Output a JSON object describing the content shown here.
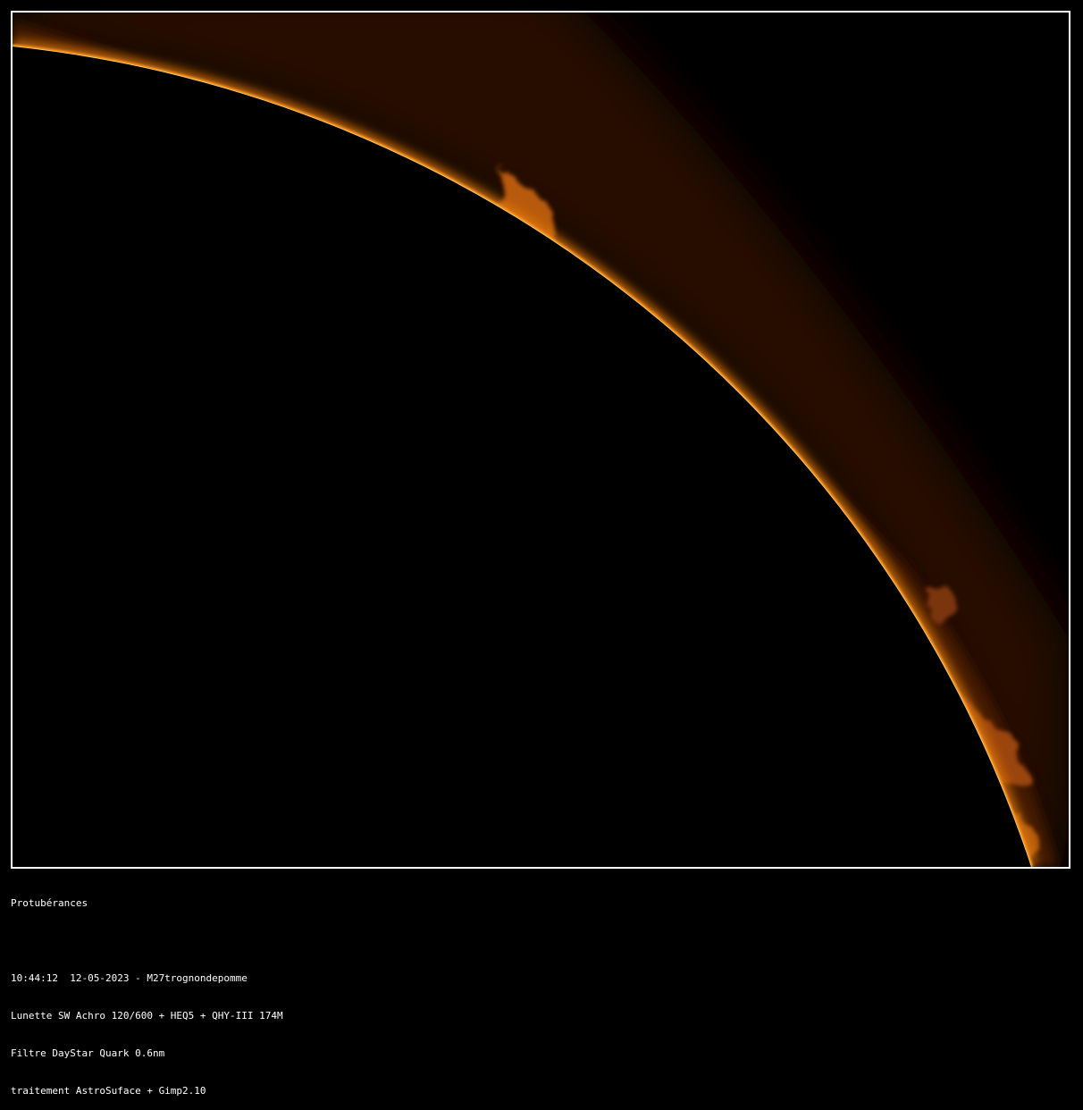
{
  "caption": {
    "title": "Protubérances",
    "lines": [
      "10:44:12  12-05-2023 - M27trognondepomme",
      "Lunette SW Achro 120/600 + HEQ5 + QHY-III 174M",
      "Filtre DayStar Quark 0.6nm",
      "traitement AstroSuface + Gimp2.10"
    ]
  },
  "image": {
    "subject": "solar-limb-with-prominences",
    "colors": {
      "background": "#000000",
      "frame_border": "#ffffff",
      "limb_bright": "#ffc040",
      "limb_orange": "#e07810",
      "corona_dark": "#3a1400",
      "corona_mid": "#5a2200",
      "prominence": "#b85a10"
    }
  }
}
